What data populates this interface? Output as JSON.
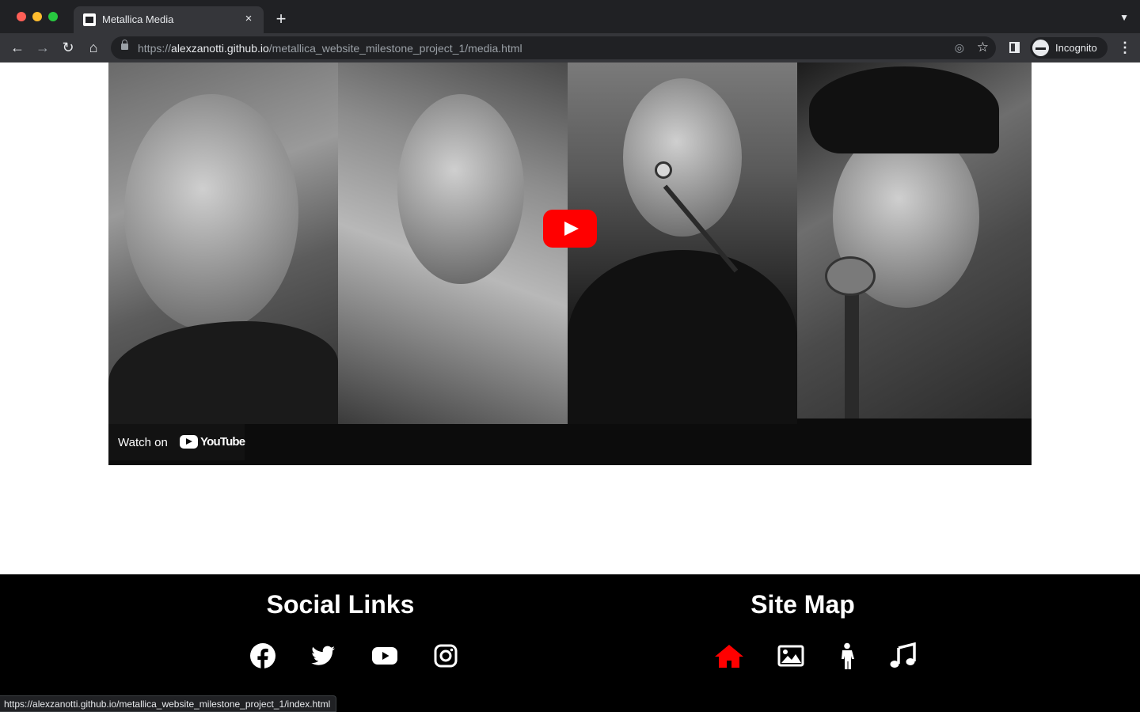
{
  "browser": {
    "tab_title": "Metallica Media",
    "tab_close": "×",
    "new_tab": "+",
    "url_scheme": "https://",
    "url_host": "alexzanotti.github.io",
    "url_path": "/metallica_website_milestone_project_1/media.html",
    "profile_label": "Incognito",
    "colors": {
      "frame": "#202124",
      "toolbar": "#35363a",
      "text": "#e8eaed"
    }
  },
  "video": {
    "watch_on_label": "Watch on",
    "youtube_wordmark": "YouTube",
    "play_button_color": "#ff0000"
  },
  "footer": {
    "social_title": "Social Links",
    "sitemap_title": "Site Map",
    "social_icons": [
      "facebook-icon",
      "twitter-icon",
      "youtube-icon",
      "instagram-icon"
    ],
    "sitemap_icons": [
      "home-icon",
      "image-icon",
      "person-icon",
      "music-icon"
    ],
    "active_color": "#ff0000"
  },
  "status_bar": {
    "hover_url": "https://alexzanotti.github.io/metallica_website_milestone_project_1/index.html"
  }
}
